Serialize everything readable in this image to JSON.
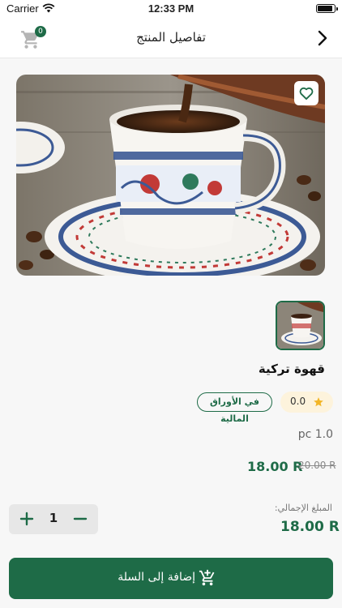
{
  "status_bar": {
    "carrier": "Carrier",
    "time": "12:33 PM"
  },
  "header": {
    "title": "تفاصيل المنتج",
    "cart_count": "0"
  },
  "product": {
    "name": "قهوة تركية",
    "rating": "0.0",
    "stock_label": "في الأوراق المالية",
    "unit": "pc 1.0",
    "price": "18.00 R",
    "old_price": "20.00 R"
  },
  "quantity": {
    "value": "1"
  },
  "total": {
    "label": "المبلغ الإجمالي:",
    "value": "18.00 R"
  },
  "add_to_cart": {
    "label": "إضافة إلى السلة"
  },
  "colors": {
    "accent": "#1e6b47",
    "rating_bg": "#fdf3dc",
    "star": "#f2b526"
  }
}
